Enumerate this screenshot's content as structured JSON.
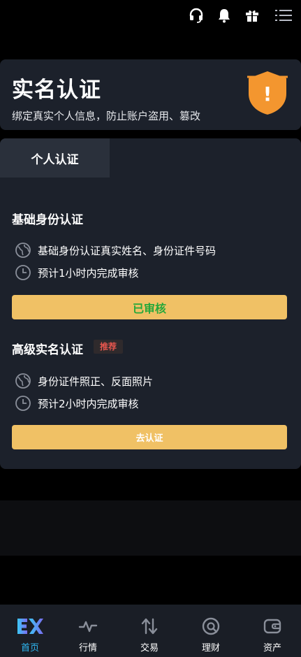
{
  "colors": {
    "background": "#000000",
    "card": "#1c212b",
    "tab_active": "#2a303b",
    "button": "#f0c165",
    "verified_text": "#25a83a",
    "recommend_text": "#e8574e",
    "nav_active": "#2fb9f5",
    "shield": "#f3962f"
  },
  "topbar": {
    "icons": [
      "headset-icon",
      "bell-icon",
      "gift-icon",
      "menu-icon"
    ]
  },
  "hero": {
    "title": "实名认证",
    "subtitle": "绑定真实个人信息，防止账户盗用、篡改",
    "badge_icon": "shield-warning-icon",
    "badge_symbol": "!"
  },
  "tabs": [
    {
      "label": "个人认证",
      "active": true
    }
  ],
  "basic": {
    "title": "基础身份认证",
    "items": [
      {
        "icon": "globe-icon",
        "text": "基础身份认证真实姓名、身份证件号码"
      },
      {
        "icon": "clock-icon",
        "text": "预计1小时内完成审核"
      }
    ],
    "button": "已审核"
  },
  "advanced": {
    "title": "高级实名认证",
    "tag": "推荐",
    "items": [
      {
        "icon": "globe-icon",
        "text": "身份证件照正、反面照片"
      },
      {
        "icon": "clock-icon",
        "text": "预计2小时内完成审核"
      }
    ],
    "button": "去认证"
  },
  "nav": {
    "items": [
      {
        "icon": "ex-logo-icon",
        "label": "首页",
        "active": true
      },
      {
        "icon": "pulse-icon",
        "label": "行情",
        "active": false
      },
      {
        "icon": "swap-icon",
        "label": "交易",
        "active": false
      },
      {
        "icon": "finance-icon",
        "label": "理财",
        "active": false
      },
      {
        "icon": "wallet-icon",
        "label": "资产",
        "active": false
      }
    ]
  }
}
